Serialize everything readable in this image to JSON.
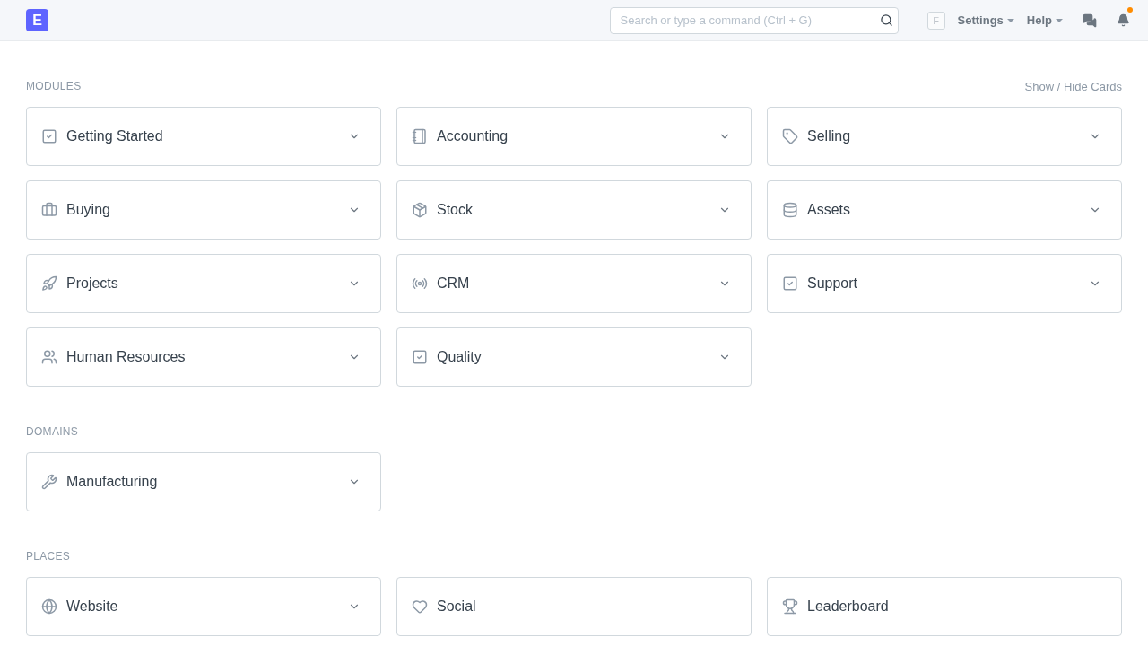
{
  "navbar": {
    "logo": "E",
    "search": {
      "placeholder": "Search or type a command (Ctrl + G)"
    },
    "avatar": "F",
    "menus": [
      "Settings",
      "Help"
    ],
    "notifications_unread": true
  },
  "sections": [
    {
      "title": "MODULES",
      "action": "Show / Hide Cards",
      "cards": [
        {
          "label": "Getting Started",
          "expandable": true
        },
        {
          "label": "Accounting",
          "expandable": true
        },
        {
          "label": "Selling",
          "expandable": true
        },
        {
          "label": "Buying",
          "expandable": true
        },
        {
          "label": "Stock",
          "expandable": true
        },
        {
          "label": "Assets",
          "expandable": true
        },
        {
          "label": "Projects",
          "expandable": true
        },
        {
          "label": "CRM",
          "expandable": true
        },
        {
          "label": "Support",
          "expandable": true
        },
        {
          "label": "Human Resources",
          "expandable": true
        },
        {
          "label": "Quality",
          "expandable": true
        }
      ]
    },
    {
      "title": "DOMAINS",
      "cards": [
        {
          "label": "Manufacturing",
          "expandable": true
        }
      ]
    },
    {
      "title": "PLACES",
      "cards": [
        {
          "label": "Website",
          "expandable": true
        },
        {
          "label": "Social",
          "expandable": false
        },
        {
          "label": "Leaderboard",
          "expandable": false
        }
      ]
    }
  ]
}
